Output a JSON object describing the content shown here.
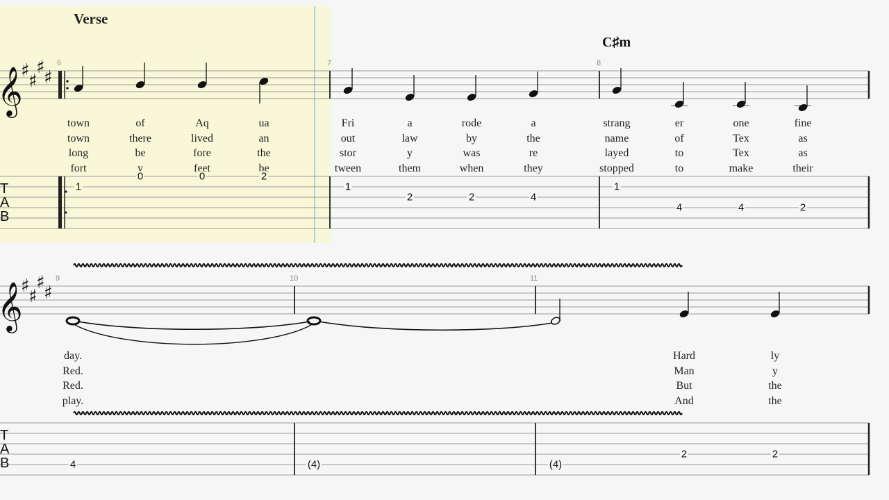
{
  "section_label": "Verse",
  "chord_label": "C♯m",
  "key_signature": "4 sharps (E major / C♯ minor)",
  "colors": {
    "highlight": "#f8f8d8",
    "cursor": "#a9d4d6",
    "background": "#f6f6f6"
  },
  "tab_label": [
    "T",
    "A",
    "B"
  ],
  "measure_numbers": [
    "6",
    "7",
    "8",
    "9",
    "10",
    "11"
  ],
  "system1": {
    "measures": [
      {
        "number": "6",
        "lyrics": [
          [
            "town",
            "of",
            "Aq",
            "ua"
          ],
          [
            "town",
            "there",
            "lived",
            "an"
          ],
          [
            "long",
            "be",
            "fore",
            "the"
          ],
          [
            "fort",
            "y",
            "feet",
            "be"
          ]
        ],
        "tab": [
          {
            "string": 2,
            "fret": "1"
          },
          {
            "string": 1,
            "fret": "0"
          },
          {
            "string": 1,
            "fret": "0"
          },
          {
            "string": 1,
            "fret": "2"
          }
        ]
      },
      {
        "number": "7",
        "lyrics": [
          [
            "Fri",
            "a",
            "rode",
            "a"
          ],
          [
            "out",
            "law",
            "by",
            "the"
          ],
          [
            "stor",
            "y",
            "was",
            "re"
          ],
          [
            "tween",
            "them",
            "when",
            "they"
          ]
        ],
        "tab": [
          {
            "string": 2,
            "fret": "1"
          },
          {
            "string": 3,
            "fret": "2"
          },
          {
            "string": 3,
            "fret": "2"
          },
          {
            "string": 3,
            "fret": "4"
          }
        ]
      },
      {
        "number": "8",
        "lyrics": [
          [
            "strang",
            "er",
            "one",
            "fine"
          ],
          [
            "name",
            "of",
            "Tex",
            "as"
          ],
          [
            "layed",
            "to",
            "Tex",
            "as"
          ],
          [
            "stopped",
            "to",
            "make",
            "their"
          ]
        ],
        "tab": [
          {
            "string": 2,
            "fret": "1"
          },
          {
            "string": 4,
            "fret": "4"
          },
          {
            "string": 4,
            "fret": "4"
          },
          {
            "string": 4,
            "fret": "2"
          }
        ]
      }
    ]
  },
  "system2": {
    "measures": [
      {
        "number": "9",
        "lyrics": [
          [
            "day."
          ],
          [
            "Red."
          ],
          [
            "Red."
          ],
          [
            "play."
          ]
        ],
        "tab": [
          {
            "string": 5,
            "fret": "4"
          }
        ]
      },
      {
        "number": "10",
        "lyrics": [],
        "tab": [
          {
            "string": 5,
            "fret": "(4)"
          }
        ]
      },
      {
        "number": "11",
        "lyrics": [
          [
            "",
            "Hard",
            "ly"
          ],
          [
            "",
            "Man",
            "y"
          ],
          [
            "",
            "But",
            "the"
          ],
          [
            "",
            "And",
            "the"
          ]
        ],
        "tab": [
          {
            "string": 5,
            "fret": "(4)"
          },
          {
            "string": 4,
            "fret": "2"
          },
          {
            "string": 4,
            "fret": "2"
          }
        ]
      }
    ]
  }
}
